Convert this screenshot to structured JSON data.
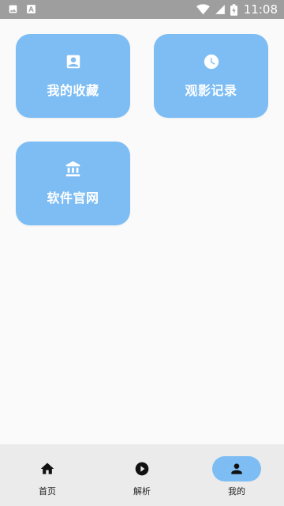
{
  "status_bar": {
    "time": "11:08",
    "left_icons": [
      "image-icon",
      "font-icon"
    ],
    "right_icons": [
      "wifi-icon",
      "signal-icon",
      "battery-icon"
    ]
  },
  "cards": [
    {
      "label": "我的收藏",
      "icon": "contact-card-icon"
    },
    {
      "label": "观影记录",
      "icon": "clock-icon"
    },
    {
      "label": "软件官网",
      "icon": "bank-icon"
    }
  ],
  "bottom_nav": {
    "items": [
      {
        "label": "首页",
        "icon": "home-icon",
        "active": false
      },
      {
        "label": "解析",
        "icon": "play-circle-icon",
        "active": false
      },
      {
        "label": "我的",
        "icon": "person-icon",
        "active": true
      }
    ]
  },
  "colors": {
    "accent": "#7dbdf4",
    "status_bar": "#9e9e9e",
    "background": "#fafafa",
    "nav_background": "#ebebeb"
  }
}
